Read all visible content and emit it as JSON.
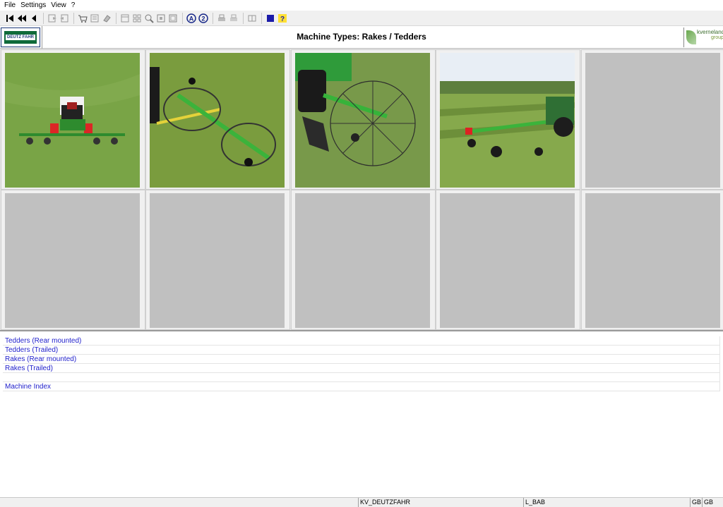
{
  "menu": {
    "items": [
      {
        "label": "File"
      },
      {
        "label": "Settings"
      },
      {
        "label": "View"
      },
      {
        "label": "?"
      }
    ]
  },
  "toolbar": {
    "buttons": [
      {
        "icon": "first-page-icon"
      },
      {
        "icon": "rewind-icon"
      },
      {
        "icon": "previous-icon"
      },
      {
        "icon": "export-icon"
      },
      {
        "icon": "import-icon"
      },
      {
        "icon": "cart-icon"
      },
      {
        "icon": "checklist-icon"
      },
      {
        "icon": "eraser-icon"
      },
      {
        "icon": "layout-icon"
      },
      {
        "icon": "grid-view-icon"
      },
      {
        "icon": "zoom-icon"
      },
      {
        "icon": "fit-page-icon"
      },
      {
        "icon": "fit-width-icon"
      },
      {
        "icon": "view-a-icon"
      },
      {
        "icon": "view-2-icon"
      },
      {
        "icon": "print-icon"
      },
      {
        "icon": "print-preview-icon"
      },
      {
        "icon": "book-icon"
      },
      {
        "icon": "stop-icon"
      },
      {
        "icon": "help-icon"
      }
    ]
  },
  "header": {
    "title": "Machine Types: Rakes / Tedders",
    "logo_left_text": "DEUTZ FAHR",
    "logo_right_text": "kverneland",
    "logo_right_sub": "group"
  },
  "grid": {
    "cells": [
      {
        "type": "photo",
        "icon": "tedder-rear-photo"
      },
      {
        "type": "photo",
        "icon": "tedder-trailed-photo"
      },
      {
        "type": "photo",
        "icon": "rake-rear-photo"
      },
      {
        "type": "photo",
        "icon": "rake-trailed-photo"
      },
      {
        "type": "empty"
      },
      {
        "type": "empty"
      },
      {
        "type": "empty"
      },
      {
        "type": "empty"
      },
      {
        "type": "empty"
      },
      {
        "type": "empty"
      }
    ]
  },
  "links": [
    {
      "label": "Tedders (Rear mounted)"
    },
    {
      "label": "Tedders (Trailed)"
    },
    {
      "label": "Rakes (Rear mounted)"
    },
    {
      "label": "Rakes (Trailed)"
    },
    {
      "label": ""
    },
    {
      "label": "Machine Index"
    }
  ],
  "status": {
    "field1": "KV_DEUTZFAHR",
    "field2": "L_BAB",
    "field3": "GB",
    "field4": "GB"
  },
  "colors": {
    "link": "#2222cc",
    "grass": "#7fa84a",
    "machine_green": "#3fae3c"
  }
}
